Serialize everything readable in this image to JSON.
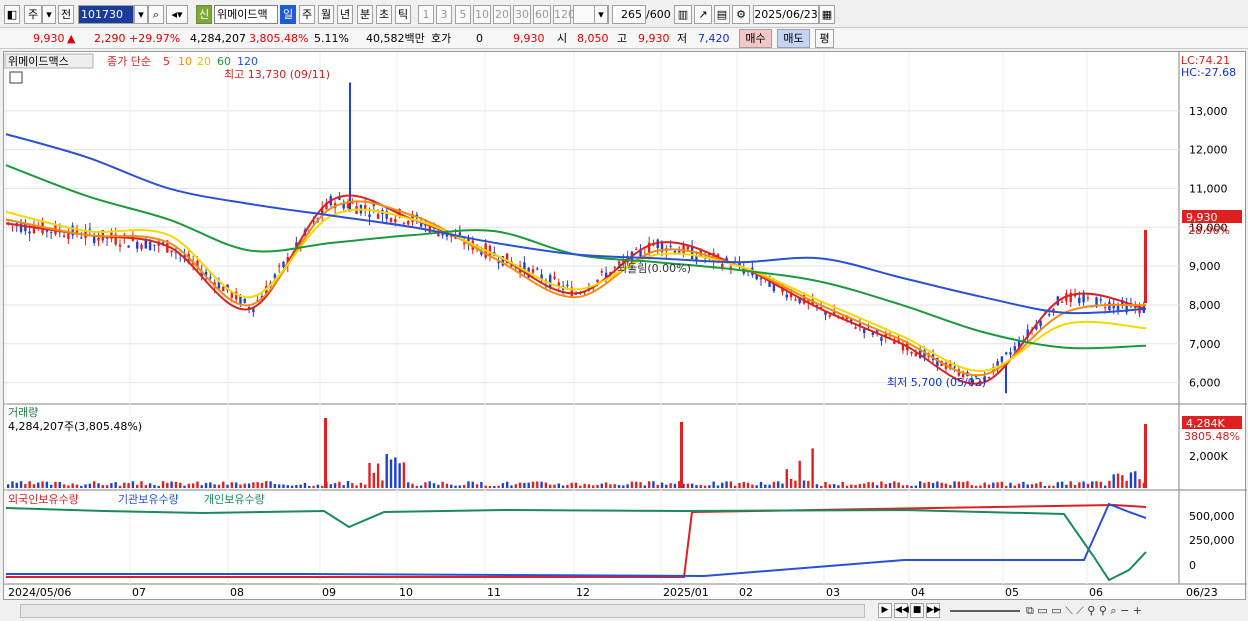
{
  "toolbar": {
    "period_prefix": "주",
    "prev_label": "전",
    "stock_code": "101730",
    "new_badge": "신",
    "stock_name": "위메이드맥",
    "periods": [
      "일",
      "주",
      "월",
      "년",
      "분",
      "초",
      "틱"
    ],
    "intervals": [
      "1",
      "3",
      "5",
      "10",
      "20",
      "30",
      "60",
      "120"
    ],
    "count": "265",
    "count_total": "/600",
    "date": "2025/06/23"
  },
  "quote": {
    "price": "9,930",
    "change": "2,290",
    "change_pct": "+29.97%",
    "volume": "4,284,207",
    "volume_ratio": "3,805.48%",
    "turnover": "5.11%",
    "amount": "40,582백만",
    "bid_label": "호가",
    "bid_value": "0",
    "ask_price": "9,930",
    "open_label": "시",
    "open_value": "8,050",
    "high_label": "고",
    "high_value": "9,930",
    "low_label": "저",
    "low_value": "7,420",
    "buy_label": "매수",
    "sell_label": "매도",
    "eval_label": "평"
  },
  "price_panel": {
    "stock_tag": "위메이드맥스",
    "ma_title": "종가 단순",
    "ma_periods": [
      "5",
      "10",
      "20",
      "60",
      "120"
    ],
    "ma_colors": [
      "#e02020",
      "#f08c10",
      "#f5d800",
      "#1a9a3a",
      "#2a50d8"
    ],
    "max_label": "최고 13,730 (09/11)",
    "min_label": "최저 5,700 (05/02)",
    "retrace_label": "되돌림(0.00%)",
    "lc_label": "LC:74.21",
    "hc_label": "HC:-27.68",
    "price_ticks": [
      "13,000",
      "12,000",
      "11,000",
      "10,000",
      "9,000",
      "8,000",
      "7,000",
      "6,000"
    ],
    "current_price_tag": "9,930",
    "current_pct": "28.96%"
  },
  "volume_panel": {
    "title": "거래량",
    "value_label": "4,284,207주(3,805.48%)",
    "tick": "2,000K",
    "current_tag": "4,284K",
    "current_pct": "3805.48%"
  },
  "holding_panel": {
    "legend": [
      "외국인보유수량",
      "기관보유수량",
      "개인보유수량"
    ],
    "ticks": [
      "500,000",
      "250,000",
      "0"
    ]
  },
  "x_axis": {
    "labels": [
      "2024/05/06",
      "07",
      "08",
      "09",
      "10",
      "11",
      "12",
      "2025/01",
      "02",
      "03",
      "04",
      "05",
      "06",
      "06/23"
    ]
  },
  "chart_data": {
    "type": "candlestick",
    "title": "위메이드맥스",
    "x": [
      "2024/05",
      "2024/06",
      "2024/07",
      "2024/08",
      "2024/09",
      "2024/10",
      "2024/11",
      "2024/12",
      "2025/01",
      "2025/02",
      "2025/03",
      "2025/04",
      "2025/05",
      "2025/06",
      "2025/06/23"
    ],
    "series": [
      {
        "name": "5",
        "values": [
          10100,
          9800,
          9500,
          7900,
          10700,
          10200,
          9300,
          8300,
          9600,
          9000,
          7900,
          7000,
          6000,
          8200,
          7900
        ]
      },
      {
        "name": "10",
        "values": [
          10200,
          9800,
          9600,
          8000,
          10500,
          10300,
          9200,
          8200,
          9400,
          9000,
          8000,
          7100,
          6200,
          7800,
          8000
        ]
      },
      {
        "name": "20",
        "values": [
          10400,
          9900,
          9800,
          8200,
          10300,
          10200,
          9300,
          8400,
          9300,
          9000,
          8100,
          7200,
          6300,
          7500,
          7400
        ]
      },
      {
        "name": "60",
        "values": [
          11600,
          10800,
          10200,
          9400,
          9600,
          9800,
          9900,
          9300,
          9100,
          8900,
          8600,
          8000,
          7300,
          6900,
          6950
        ]
      },
      {
        "name": "120",
        "values": [
          12400,
          11800,
          11000,
          10600,
          10300,
          10000,
          9600,
          9300,
          9200,
          9100,
          9200,
          8700,
          8200,
          7800,
          7900
        ]
      }
    ],
    "ylim": [
      5500,
      14000
    ],
    "last_price": 9930,
    "max": {
      "value": 13730,
      "date": "09/11"
    },
    "min": {
      "value": 5700,
      "date": "05/02"
    }
  }
}
